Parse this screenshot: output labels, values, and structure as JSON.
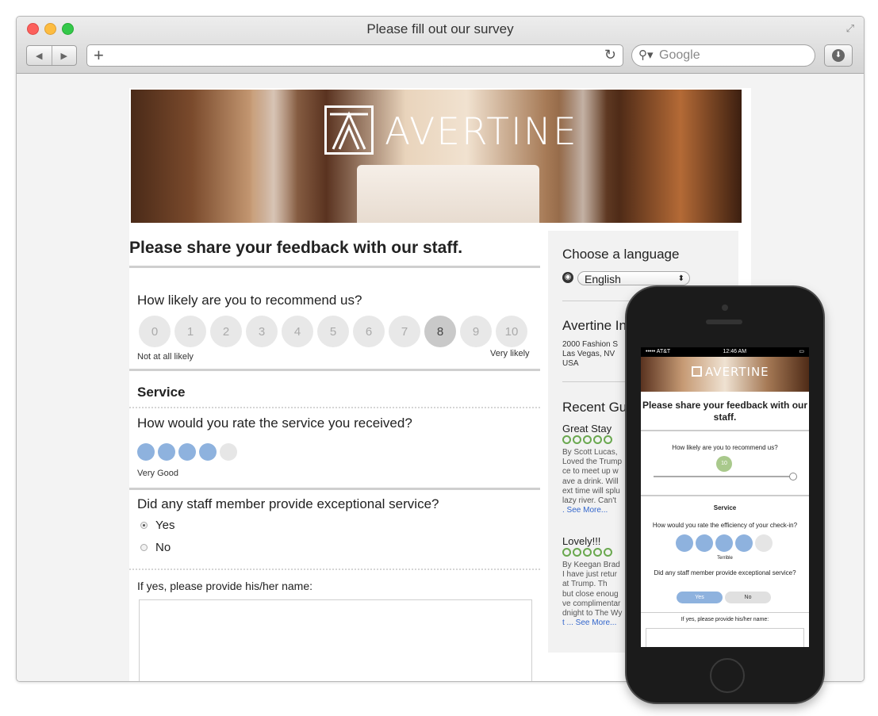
{
  "browser": {
    "title": "Please fill out our survey",
    "search_placeholder": "Google",
    "icons": [
      "back-icon",
      "forward-icon",
      "plus-icon",
      "reload-icon",
      "search-icon",
      "download-icon"
    ]
  },
  "header": {
    "brand": "AVERTINE"
  },
  "survey": {
    "heading": "Please share your feedback with our staff.",
    "nps_question": "How likely are you to recommend us?",
    "nps_options": [
      "0",
      "1",
      "2",
      "3",
      "4",
      "5",
      "6",
      "7",
      "8",
      "9",
      "10"
    ],
    "nps_selected": 8,
    "nps_low_label": "Not at all likely",
    "nps_high_label": "Very likely",
    "section_title": "Service",
    "service_question": "How would you rate the service you received?",
    "service_rating": 4,
    "service_rating_max": 5,
    "service_rating_label": "Very Good",
    "staff_question": "Did any staff member provide exceptional service?",
    "staff_yes": "Yes",
    "staff_no": "No",
    "staff_selected": "Yes",
    "name_prompt": "If yes, please provide his/her name:"
  },
  "sidebar": {
    "language_heading": "Choose a language",
    "language_value": "English",
    "info_heading": "Avertine In",
    "address_line1": "2000 Fashion S",
    "address_line2": "Las Vegas, NV",
    "address_line3": "USA",
    "reviews_heading": "Recent Gu",
    "reviews": [
      {
        "title": "Great Stay",
        "lines": [
          "By Scott Lucas,",
          "Loved the Trump",
          "ce to meet up w",
          "ave a drink. Will",
          "ext time will splu",
          "lazy river. Can't"
        ],
        "more": ". See More..."
      },
      {
        "title": "Lovely!!!",
        "lines": [
          "By Keegan Brad",
          "I have just retur",
          "at Trump. Th",
          "but close enoug",
          "ve complimentar",
          "dnight to The Wy"
        ],
        "more": "t ...  See More..."
      }
    ]
  },
  "phone": {
    "carrier": "••••• AT&T",
    "time": "12:46 AM",
    "brand": "AVERTINE",
    "heading": "Please share your feedback with our staff.",
    "nps_question": "How likely are you to recommend us?",
    "nps_value": "10",
    "section_title": "Service",
    "checkin_question": "How would you rate the efficiency of your check-in?",
    "rating_label": "Terrible",
    "staff_question": "Did any staff member provide exceptional service?",
    "yes": "Yes",
    "no": "No",
    "name_prompt": "If yes, please provide his/her name:"
  },
  "colors": {
    "rating_on": "#8eb2de",
    "link": "#3366cc",
    "review_rating": "#6aa84f"
  }
}
